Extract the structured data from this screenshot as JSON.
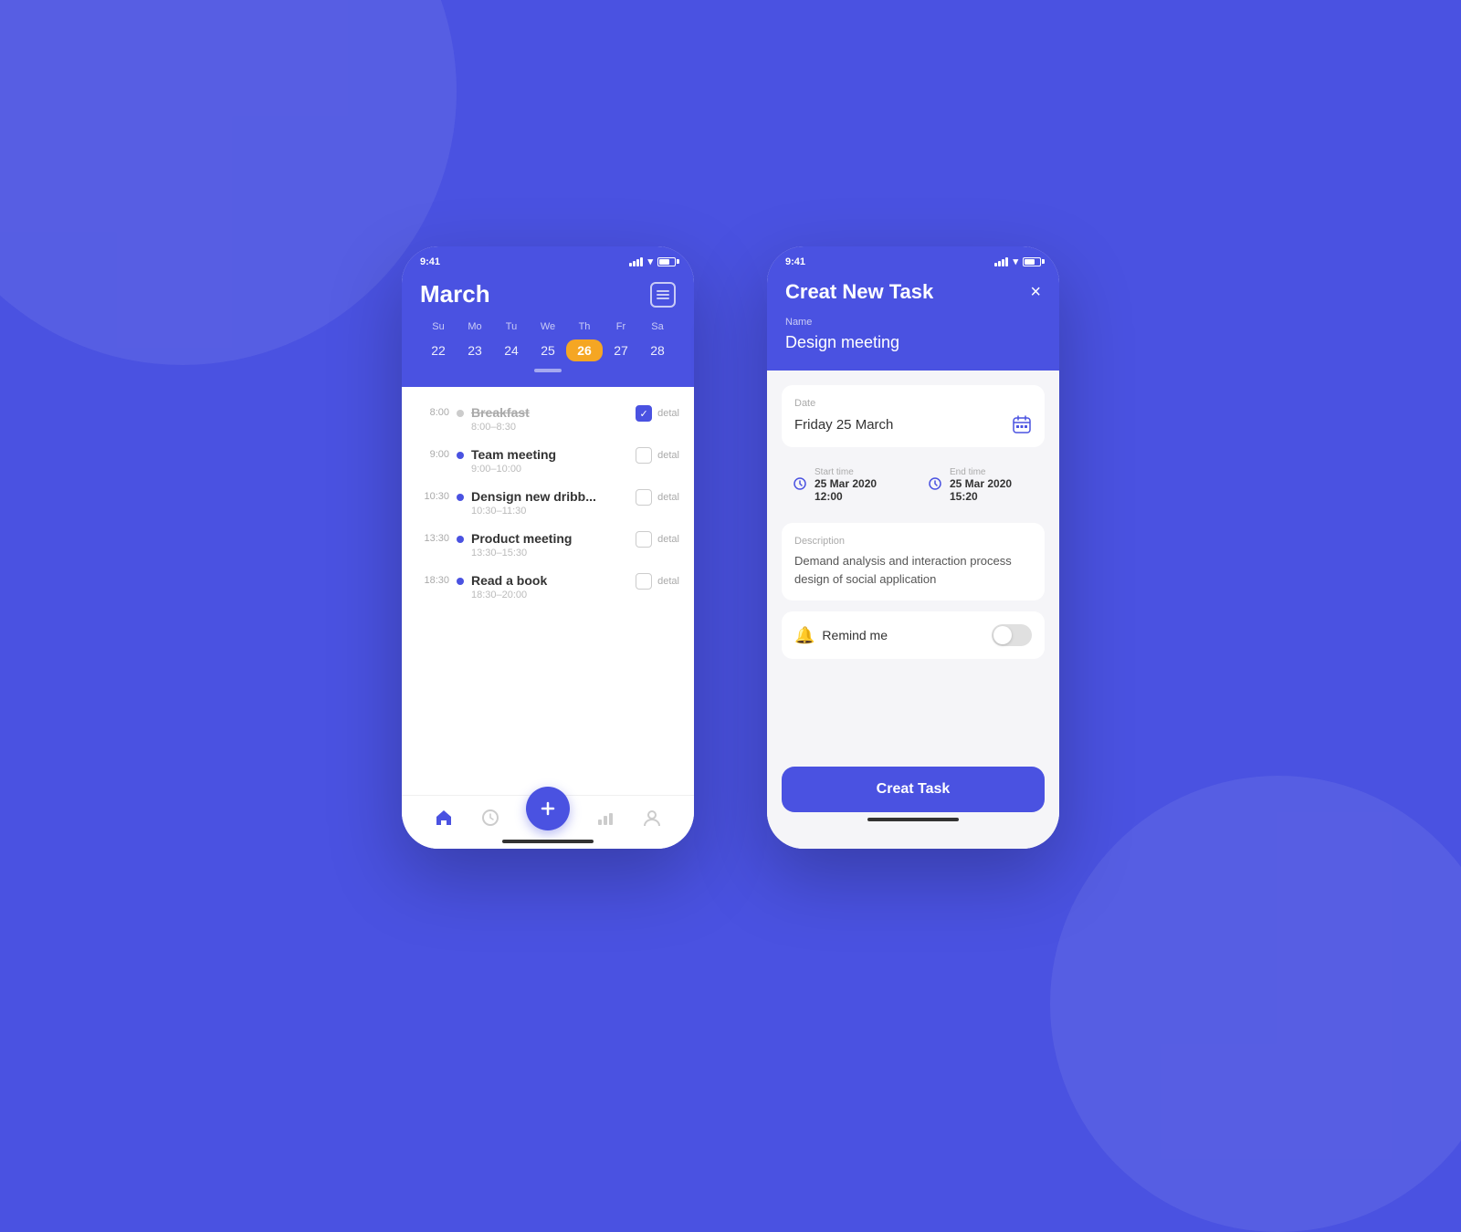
{
  "background_color": "#4A52E1",
  "phone1": {
    "status_time": "9:41",
    "header": {
      "month": "March",
      "calendar_icon_label": "calendar"
    },
    "week_days": [
      "Su",
      "Mo",
      "Tu",
      "We",
      "Th",
      "Fr",
      "Sa"
    ],
    "week_dates": [
      "22",
      "23",
      "24",
      "25",
      "26",
      "27",
      "28"
    ],
    "active_date": "26",
    "active_day": "Th",
    "tasks": [
      {
        "time": "8:00",
        "name": "Breakfast",
        "time_range": "8:00–8:30",
        "done": true,
        "dot": "grey"
      },
      {
        "time": "9:00",
        "name": "Team meeting",
        "time_range": "9:00–10:00",
        "done": false,
        "dot": "blue"
      },
      {
        "time": "10:30",
        "name": "Densign new dribb...",
        "time_range": "10:30–11:30",
        "done": false,
        "dot": "blue"
      },
      {
        "time": "13:30",
        "name": "Product meeting",
        "time_range": "13:30–15:30",
        "done": false,
        "dot": "blue"
      },
      {
        "time": "18:30",
        "name": "Read a book",
        "time_range": "18:30–20:00",
        "done": false,
        "dot": "blue"
      }
    ],
    "nav": {
      "home_label": "home",
      "clock_label": "clock",
      "plus_label": "+",
      "chart_label": "chart",
      "profile_label": "profile"
    }
  },
  "phone2": {
    "status_time": "9:41",
    "header": {
      "title": "Creat New Task",
      "close_label": "×",
      "name_label": "Name",
      "name_value": "Design meeting"
    },
    "form": {
      "date_label": "Date",
      "date_value": "Friday 25 March",
      "start_time_label": "Start time",
      "start_time_value": "25 Mar 2020  12:00",
      "end_time_label": "End time",
      "end_time_value": "25 Mar 2020  15:20",
      "description_label": "Description",
      "description_value": "Demand analysis and interaction process design of social application",
      "remind_label": "Remind me",
      "toggle_state": "off"
    },
    "create_button_label": "Creat Task"
  }
}
